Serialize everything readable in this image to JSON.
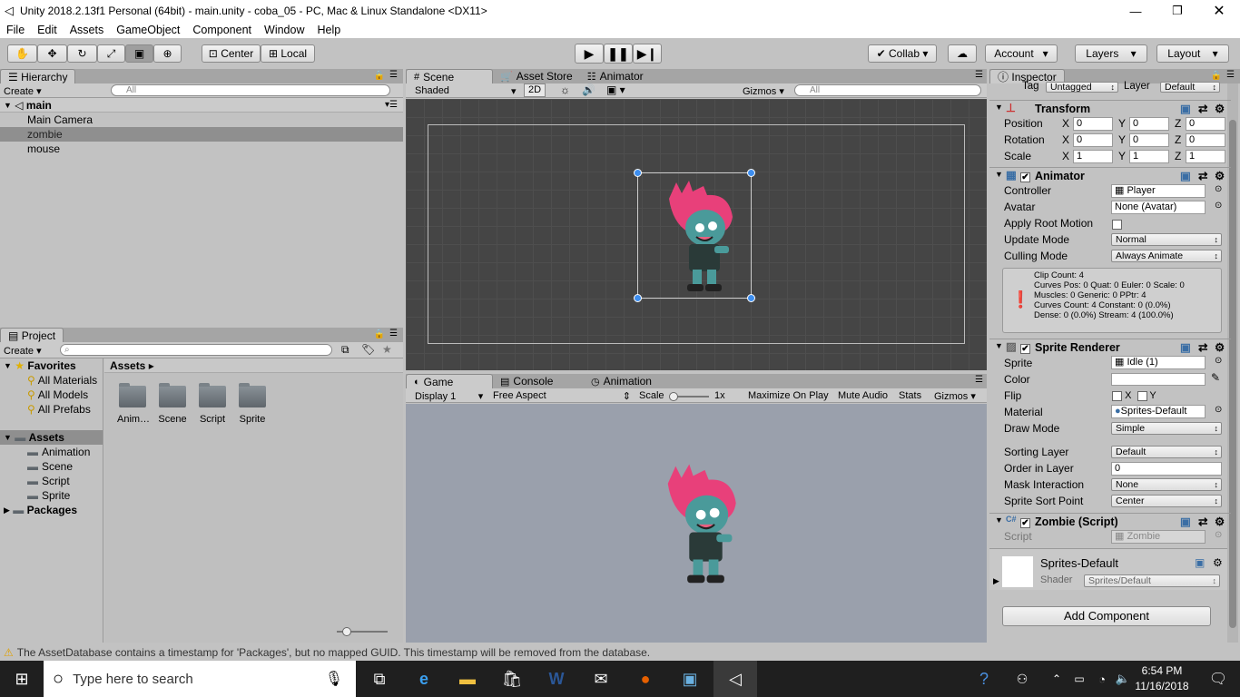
{
  "window": {
    "title": "Unity 2018.2.13f1 Personal (64bit) - main.unity - coba_05 - PC, Mac & Linux Standalone <DX11>"
  },
  "menu": [
    "File",
    "Edit",
    "Assets",
    "GameObject",
    "Component",
    "Window",
    "Help"
  ],
  "toolbar": {
    "center": "Center",
    "local": "Local",
    "collab": "Collab",
    "account": "Account",
    "layers": "Layers",
    "layout": "Layout"
  },
  "hierarchy": {
    "tab": "Hierarchy",
    "create": "Create",
    "search_placeholder": "All",
    "scene": "main",
    "items": [
      "Main Camera",
      "zombie",
      "mouse"
    ],
    "selected": "zombie"
  },
  "project": {
    "tab": "Project",
    "create": "Create",
    "favorites": "Favorites",
    "favorite_items": [
      "All Materials",
      "All Models",
      "All Prefabs"
    ],
    "assets": "Assets",
    "asset_children": [
      "Animation",
      "Scene",
      "Script",
      "Sprite"
    ],
    "packages": "Packages",
    "breadcrumb": "Assets",
    "folders": [
      "Anim…",
      "Scene",
      "Script",
      "Sprite"
    ]
  },
  "scene": {
    "tabs": [
      "Scene",
      "Asset Store",
      "Animator"
    ],
    "shading": "Shaded",
    "mode2d": "2D",
    "gizmos": "Gizmos",
    "search_placeholder": "All"
  },
  "game": {
    "tabs": [
      "Game",
      "Console",
      "Animation"
    ],
    "display": "Display 1",
    "aspect": "Free Aspect",
    "scale_label": "Scale",
    "scale_value": "1x",
    "maximize": "Maximize On Play",
    "mute": "Mute Audio",
    "stats": "Stats",
    "gizmos": "Gizmos"
  },
  "inspector": {
    "tab": "Inspector",
    "tag_label": "Tag",
    "tag": "Untagged",
    "layer_label": "Layer",
    "layer": "Default",
    "transform": {
      "title": "Transform",
      "position_label": "Position",
      "rotation_label": "Rotation",
      "scale_label": "Scale",
      "position": [
        "0",
        "0",
        "0"
      ],
      "rotation": [
        "0",
        "0",
        "0"
      ],
      "scale": [
        "1",
        "1",
        "1"
      ]
    },
    "animator": {
      "title": "Animator",
      "controller_label": "Controller",
      "controller": "Player",
      "avatar_label": "Avatar",
      "avatar": "None (Avatar)",
      "apply_root_label": "Apply Root Motion",
      "update_mode_label": "Update Mode",
      "update_mode": "Normal",
      "culling_mode_label": "Culling Mode",
      "culling_mode": "Always Animate",
      "info": [
        "Clip Count: 4",
        "Curves Pos: 0 Quat: 0 Euler: 0 Scale: 0",
        "Muscles: 0 Generic: 0 PPtr: 4",
        "Curves Count: 4 Constant: 0 (0.0%)",
        "Dense: 0 (0.0%) Stream: 4 (100.0%)"
      ]
    },
    "sprite_renderer": {
      "title": "Sprite Renderer",
      "sprite_label": "Sprite",
      "sprite": "Idle (1)",
      "color_label": "Color",
      "flip_label": "Flip",
      "flip_x": "X",
      "flip_y": "Y",
      "material_label": "Material",
      "material": "Sprites-Default",
      "draw_mode_label": "Draw Mode",
      "draw_mode": "Simple",
      "sorting_layer_label": "Sorting Layer",
      "sorting_layer": "Default",
      "order_label": "Order in Layer",
      "order": "0",
      "mask_label": "Mask Interaction",
      "mask": "None",
      "sort_point_label": "Sprite Sort Point",
      "sort_point": "Center"
    },
    "zombie": {
      "title": "Zombie (Script)",
      "script_label": "Script",
      "script": "Zombie"
    },
    "material": {
      "name": "Sprites-Default",
      "shader_label": "Shader",
      "shader": "Sprites/Default"
    },
    "add_component": "Add Component"
  },
  "status": "The AssetDatabase contains a timestamp for 'Packages', but no mapped GUID. This timestamp will be removed from the database.",
  "taskbar": {
    "search_placeholder": "Type here to search",
    "time": "6:54 PM",
    "date": "11/16/2018"
  }
}
